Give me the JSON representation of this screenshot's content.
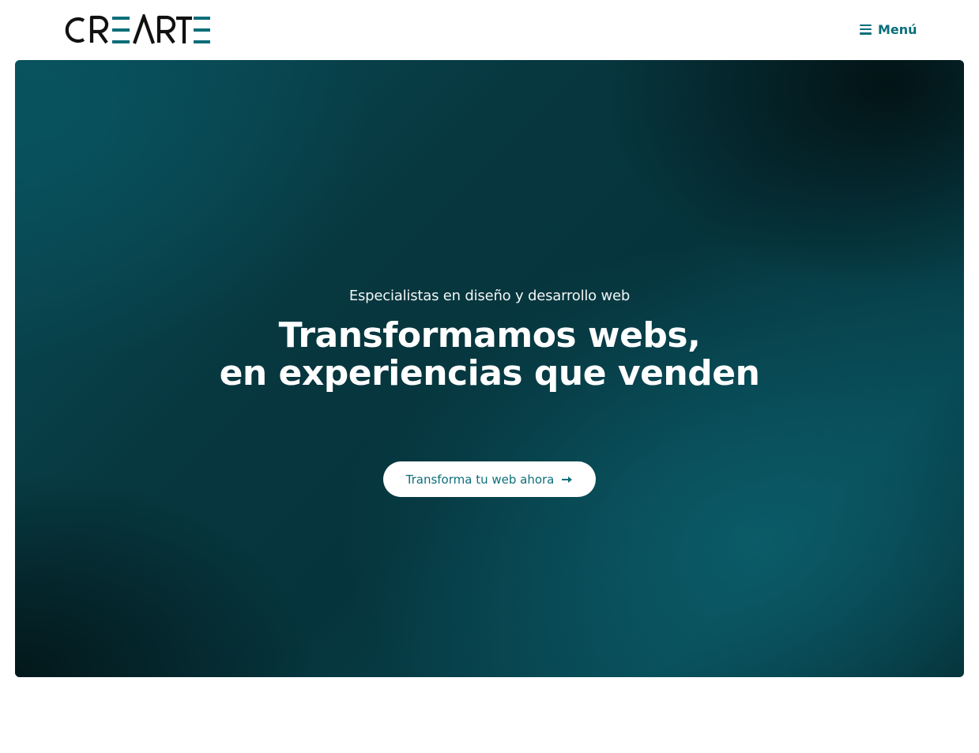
{
  "header": {
    "logo_text": "CREARTE",
    "menu_label": "Menú"
  },
  "hero": {
    "eyebrow": "Especialistas en diseño y desarrollo web",
    "headline_line1": "Transformamos webs,",
    "headline_line2": "en experiencias que venden",
    "cta_label": "Transforma tu web ahora"
  },
  "colors": {
    "brand_teal": "#0b6e7a",
    "hero_dark": "#06343c",
    "text_dark": "#111111"
  },
  "icons": {
    "menu": "hamburger-icon",
    "cta": "arrow-right-icon"
  }
}
